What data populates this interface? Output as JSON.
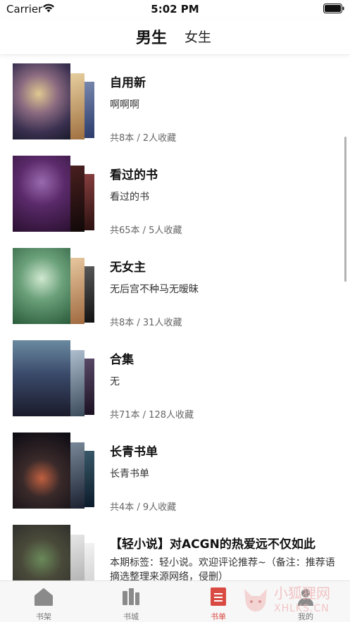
{
  "status_bar": {
    "carrier": "Carrier",
    "time": "5:02 PM"
  },
  "top_tabs": {
    "male": "男生",
    "female": "女生"
  },
  "booklists": [
    {
      "title": "自用新",
      "desc": "啊啊啊",
      "meta": "共8本 / 2人收藏",
      "covers": [
        "#3a4a6a",
        "#c8a070",
        "#5a5a8a"
      ]
    },
    {
      "title": "看过的书",
      "desc": "看过的书",
      "meta": "共65本 / 5人收藏",
      "covers": [
        "#5a2a6a",
        "#3a1a1a",
        "#6a3030"
      ]
    },
    {
      "title": "无女主",
      "desc": "无后宫不种马无暧昧",
      "meta": "共8本 / 31人收藏",
      "covers": [
        "#3a6a4a",
        "#c09060",
        "#2a2a2a"
      ]
    },
    {
      "title": "合集",
      "desc": "无",
      "meta": "共71本 / 128人收藏",
      "covers": [
        "#2a3a5a",
        "#4a5a6a",
        "#3a2a3a"
      ]
    },
    {
      "title": "长青书单",
      "desc": "长青书单",
      "meta": "共4本 / 9人收藏",
      "covers": [
        "#1a1a2a",
        "#3a4a5a",
        "#2a3a4a"
      ]
    },
    {
      "title": "【轻小说】对ACGN的热爱远不仅如此",
      "desc": "本期标签：轻小说。欢迎评论推荐~（备注：推荐语摘选整理来源网络，侵删）",
      "meta": "",
      "covers": [
        "#3a3a3a",
        "#dcdcdc",
        "#e8e8e8"
      ]
    }
  ],
  "tabbar": [
    {
      "label": "书架",
      "icon": "house-icon"
    },
    {
      "label": "书城",
      "icon": "bookstore-icon"
    },
    {
      "label": "书单",
      "icon": "booklist-icon"
    },
    {
      "label": "我的",
      "icon": "person-icon"
    }
  ],
  "watermark": {
    "text": "小狐狸网",
    "sub": "XHLKS.CN"
  },
  "colors": {
    "accent": "#d84a42",
    "text": "#111111",
    "secondary": "#666666",
    "tabbar_bg": "#f7f7f7"
  }
}
